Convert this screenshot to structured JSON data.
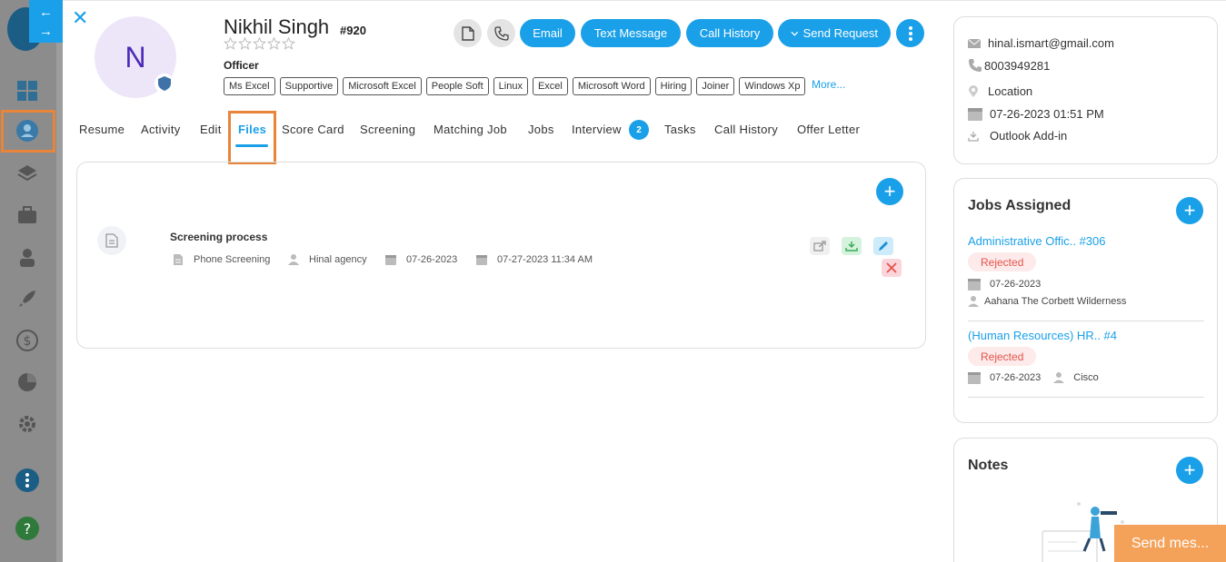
{
  "candidate": {
    "initial": "N",
    "name": "Nikhil Singh",
    "id": "#920",
    "title": "Officer",
    "rating": 0,
    "skills": [
      "Ms Excel",
      "Supportive",
      "Microsoft Excel",
      "People Soft",
      "Linux",
      "Excel",
      "Microsoft Word",
      "Hiring",
      "Joiner",
      "Windows Xp"
    ],
    "more_label": "More..."
  },
  "actions": {
    "email": "Email",
    "text_message": "Text Message",
    "call_history": "Call History",
    "send_request": "Send Request"
  },
  "tabs": [
    {
      "label": "Resume"
    },
    {
      "label": "Activity"
    },
    {
      "label": "Edit"
    },
    {
      "label": "Files",
      "active": true
    },
    {
      "label": "Score Card"
    },
    {
      "label": "Screening"
    },
    {
      "label": "Matching Job"
    },
    {
      "label": "Jobs"
    },
    {
      "label": "Interview",
      "badge": "2"
    },
    {
      "label": "Tasks"
    },
    {
      "label": "Call History"
    },
    {
      "label": "Offer Letter"
    }
  ],
  "files": [
    {
      "title": "Screening process",
      "type": "Phone Screening",
      "owner": "Hinal agency",
      "date": "07-26-2023",
      "datetime": "07-27-2023 11:34 AM"
    }
  ],
  "contact": {
    "email": "hinal.ismart@gmail.com",
    "phone": "8003949281",
    "location": "Location",
    "datetime": "07-26-2023 01:51 PM",
    "outlook": "Outlook Add-in"
  },
  "jobs_assigned": {
    "title": "Jobs Assigned",
    "items": [
      {
        "job": "Administrative Offic.. #306",
        "status": "Rejected",
        "date": "07-26-2023",
        "company": "Aahana The Corbett Wilderness"
      },
      {
        "job": "(Human Resources) HR.. #4",
        "status": "Rejected",
        "date": "07-26-2023",
        "company": "Cisco"
      }
    ]
  },
  "notes": {
    "title": "Notes"
  },
  "chat": {
    "label": "Send mes..."
  },
  "colors": {
    "accent": "#1aa0e8",
    "highlight": "#e8853a",
    "danger": "#e5534b",
    "chat": "#f4a259"
  }
}
